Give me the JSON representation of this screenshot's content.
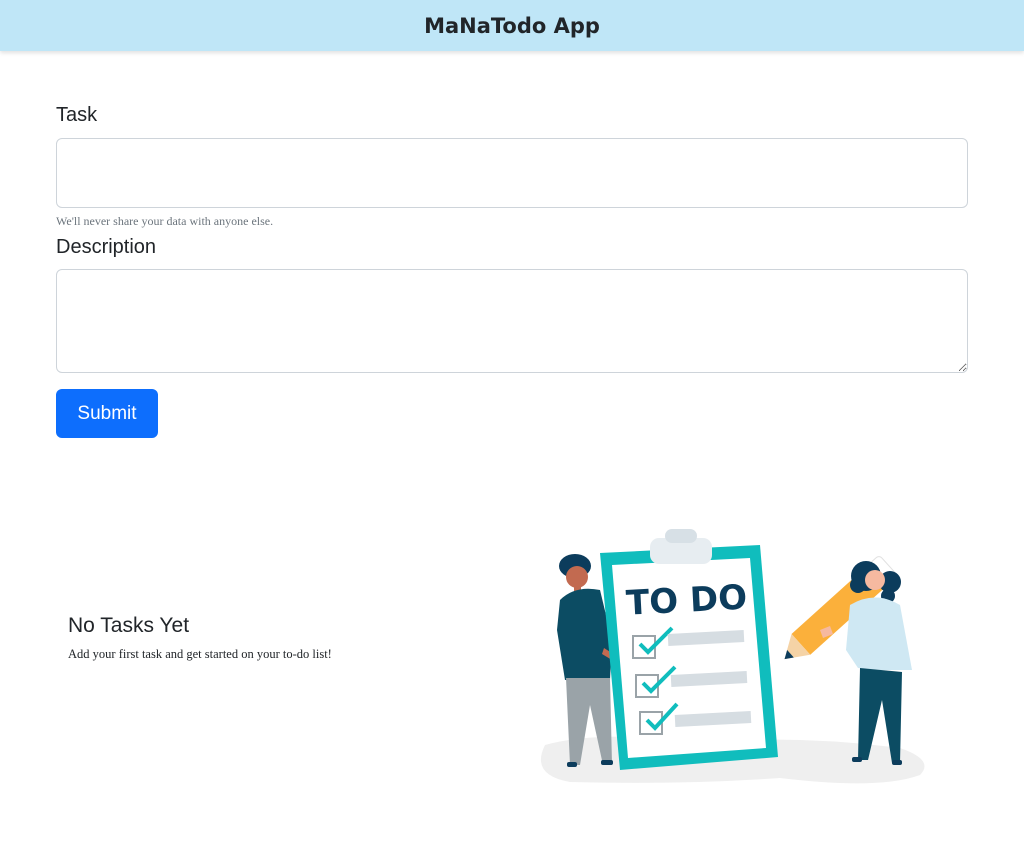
{
  "app": {
    "title": "MaNaTodo App"
  },
  "form": {
    "task_label": "Task",
    "task_value": "",
    "task_help": "We'll never share your data with anyone else.",
    "description_label": "Description",
    "description_value": "",
    "submit_label": "Submit"
  },
  "empty_state": {
    "title": "No Tasks Yet",
    "message": "Add your first task and get started on your to-do list!"
  },
  "illustration": {
    "heading": "TO DO",
    "icon": "todo-clipboard-illustration",
    "colors": {
      "teal": "#10bdbd",
      "navy": "#0c3c5c",
      "orange": "#fbb03b",
      "skin": "#c26a50",
      "light_blue": "#cfe8f3"
    }
  },
  "colors": {
    "navbar_bg": "#bfe6f7",
    "primary": "#0d6efd",
    "muted": "#6c757d"
  }
}
